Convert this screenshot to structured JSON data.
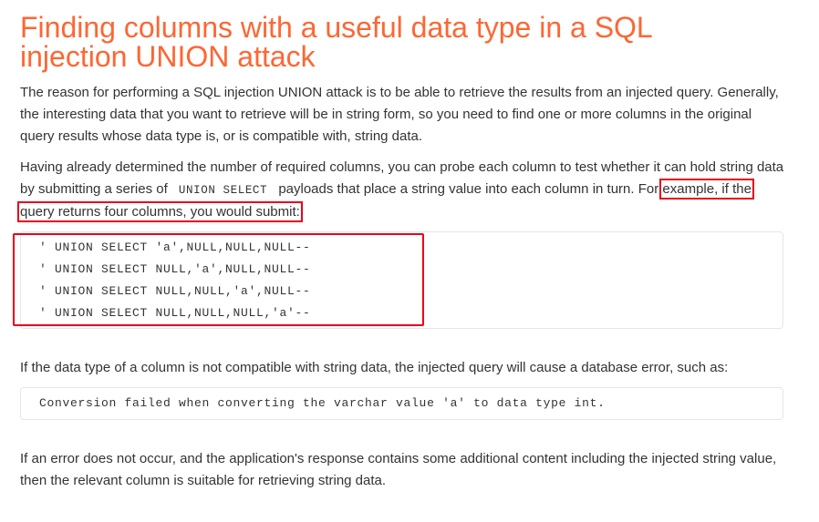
{
  "heading": "Finding columns with a useful data type in a SQL injection UNION attack",
  "para1": "The reason for performing a SQL injection UNION attack is to be able to retrieve the results from an injected query. Generally, the interesting data that you want to retrieve will be in string form, so you need to find one or more columns in the original query results whose data type is, or is compatible with, string data.",
  "para2": {
    "before_code": "Having already determined the number of required columns, you can probe each column to test whether it can hold string data by submitting a series of",
    "inline_code": "UNION SELECT",
    "after_code": "payloads that place a string value into each column in turn. For",
    "highlighted": "example, if the query returns four columns, you would submit:"
  },
  "code_block_1": [
    "' UNION SELECT 'a',NULL,NULL,NULL--",
    "' UNION SELECT NULL,'a',NULL,NULL--",
    "' UNION SELECT NULL,NULL,'a',NULL--",
    "' UNION SELECT NULL,NULL,NULL,'a'--"
  ],
  "para3": "If the data type of a column is not compatible with string data, the injected query will cause a database error, such as:",
  "code_block_2": "Conversion failed when converting the varchar value 'a' to data type int.",
  "para4": "If an error does not occur, and the application's response contains some additional content including the injected string value, then the relevant column is suitable for retrieving string data.",
  "colors": {
    "heading": "#ff6633",
    "text": "#333333",
    "highlight_border": "#e8001c",
    "code_border": "#e6e6e6"
  }
}
